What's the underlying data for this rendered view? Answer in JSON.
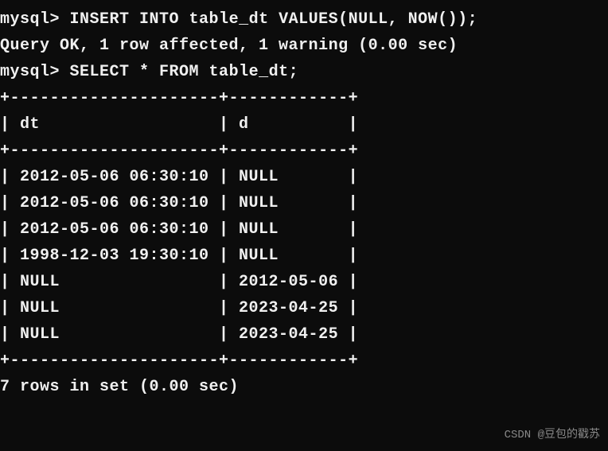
{
  "terminal": {
    "prompt": "mysql>",
    "cmd1": "INSERT INTO table_dt VALUES(NULL, NOW());",
    "result1": "Query OK, 1 row affected, 1 warning (0.00 sec)",
    "blank": "",
    "cmd2": "SELECT * FROM table_dt;",
    "sep_top": "+---------------------+------------+",
    "header": "| dt                  | d          |",
    "sep_mid": "+---------------------+------------+",
    "row0": "| 2012-05-06 06:30:10 | NULL       |",
    "row1": "| 2012-05-06 06:30:10 | NULL       |",
    "row2": "| 2012-05-06 06:30:10 | NULL       |",
    "row3": "| 1998-12-03 19:30:10 | NULL       |",
    "row4": "| NULL                | 2012-05-06 |",
    "row5": "| NULL                | 2023-04-25 |",
    "row6": "| NULL                | 2023-04-25 |",
    "sep_bot": "+---------------------+------------+",
    "summary": "7 rows in set (0.00 sec)"
  },
  "chart_data": {
    "type": "table",
    "columns": [
      "dt",
      "d"
    ],
    "rows": [
      [
        "2012-05-06 06:30:10",
        "NULL"
      ],
      [
        "2012-05-06 06:30:10",
        "NULL"
      ],
      [
        "2012-05-06 06:30:10",
        "NULL"
      ],
      [
        "1998-12-03 19:30:10",
        "NULL"
      ],
      [
        "NULL",
        "2012-05-06"
      ],
      [
        "NULL",
        "2023-04-25"
      ],
      [
        "NULL",
        "2023-04-25"
      ]
    ]
  },
  "watermark": "CSDN @豆包的戳苏"
}
